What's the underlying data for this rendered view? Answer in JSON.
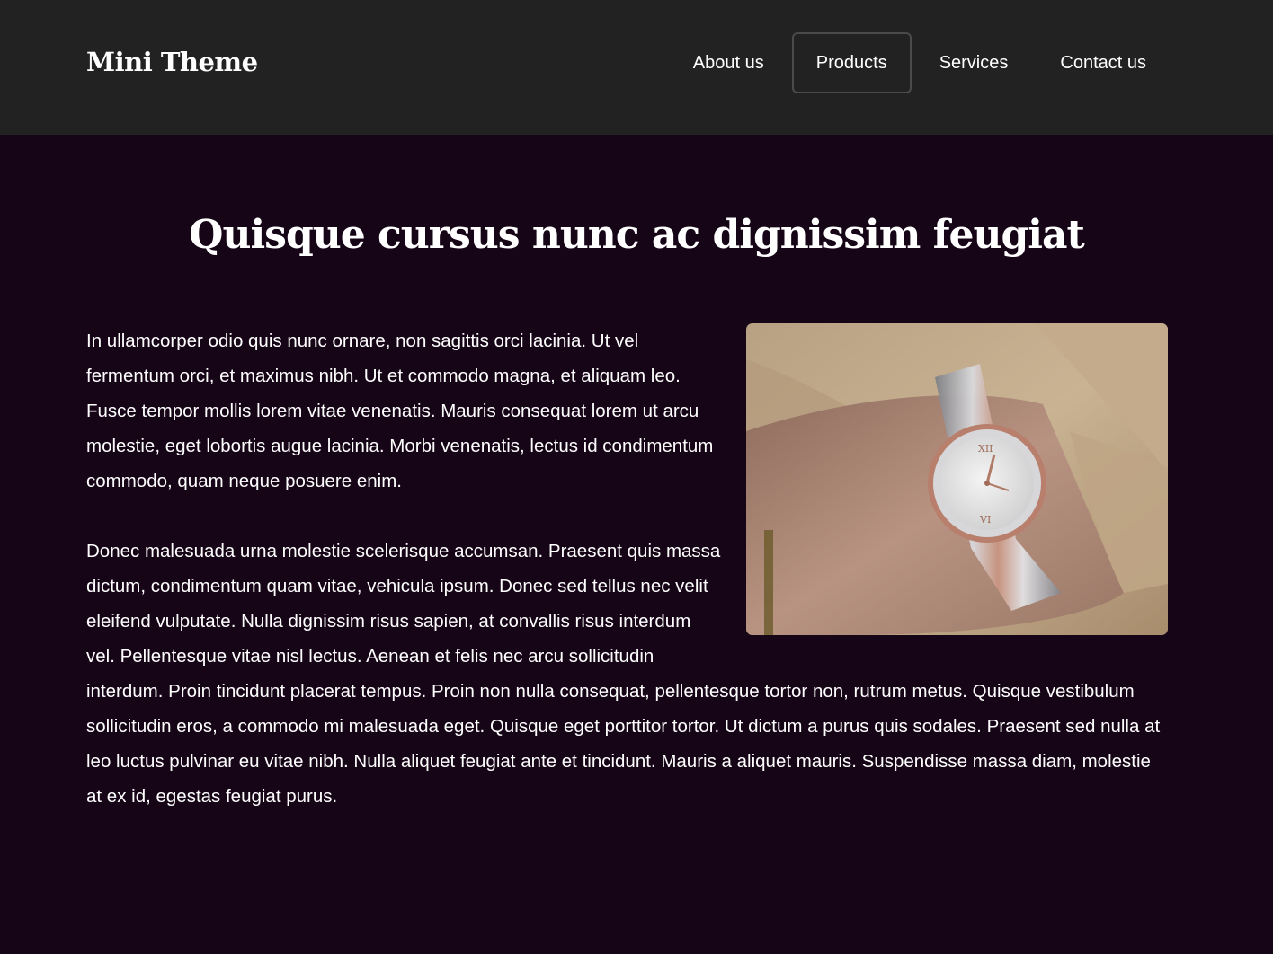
{
  "header": {
    "brand": "Mini Theme",
    "nav": [
      {
        "label": "About us",
        "active": false
      },
      {
        "label": "Products",
        "active": true
      },
      {
        "label": "Services",
        "active": false
      },
      {
        "label": "Contact us",
        "active": false
      }
    ]
  },
  "main": {
    "title": "Quisque cursus nunc ac dignissim feugiat",
    "paragraphs": [
      "In ullamcorper odio quis nunc ornare, non sagittis orci lacinia. Ut vel fermentum orci, et maximus nibh. Ut et commodo magna, et aliquam leo. Fusce tempor mollis lorem vitae venenatis. Mauris consequat lorem ut arcu molestie, eget lobortis augue lacinia. Morbi venenatis, lectus id condimentum commodo, quam neque posuere enim.",
      "Donec malesuada urna molestie scelerisque accumsan. Praesent quis massa dictum, condimentum quam vitae, vehicula ipsum. Donec sed tellus nec velit eleifend vulputate. Nulla dignissim risus sapien, at convallis risus interdum vel. Pellentesque vitae nisl lectus. Aenean et felis nec arcu sollicitudin interdum. Proin tincidunt placerat tempus. Proin non nulla consequat, pellentesque tortor non, rutrum metus. Quisque vestibulum sollicitudin eros, a commodo mi malesuada eget. Quisque eget porttitor tortor. Ut dictum a purus quis sodales. Praesent sed nulla at leo luctus pulvinar eu vitae nibh. Nulla aliquet feugiat ante et tincidunt. Mauris a aliquet mauris. Suspendisse massa diam, molestie at ex id, egestas feugiat purus."
    ],
    "image": {
      "subject": "wristwatch-photo"
    }
  },
  "colors": {
    "header_bg": "#222222",
    "page_bg": "#160516",
    "text": "#ffffff",
    "active_border": "#4a4a4a"
  }
}
